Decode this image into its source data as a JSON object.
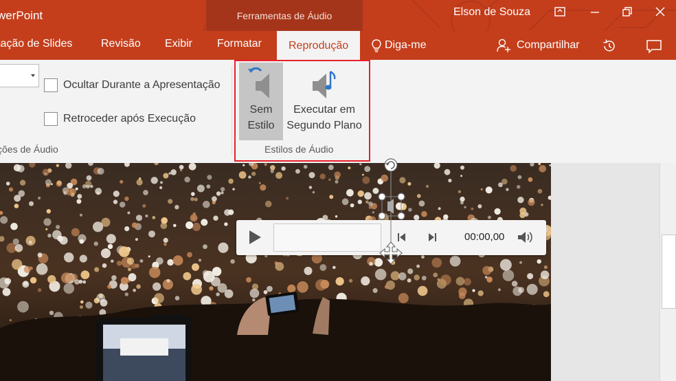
{
  "window": {
    "app_title": "werPoint",
    "tools_tab": "Ferramentas de Áudio",
    "user_name": "Elson de Souza",
    "controls": [
      "ribbon-display-icon",
      "minimize-icon",
      "restore-icon",
      "close-icon"
    ]
  },
  "tabs": [
    {
      "label": "tação de Slides",
      "active": false
    },
    {
      "label": "Revisão",
      "active": false
    },
    {
      "label": "Exibir",
      "active": false
    },
    {
      "label": "Formatar",
      "active": false
    },
    {
      "label": "Reprodução",
      "active": true
    }
  ],
  "tell_me": {
    "label": "Diga-me",
    "icon": "lightbulb-icon"
  },
  "share": {
    "label": "Compartilhar",
    "icon": "add-person-icon"
  },
  "toolbar_icons": [
    "history-icon",
    "comment-icon"
  ],
  "ribbon": {
    "audio_options": {
      "dropdown_value": "",
      "hide_during_show": {
        "label": "Ocultar Durante a Apresentação",
        "checked": false
      },
      "rewind_after_play": {
        "label": "Retroceder após Execução",
        "checked": false
      },
      "group_label": "ções de Áudio"
    },
    "audio_styles": {
      "no_style": {
        "line1": "Sem",
        "line2": "Estilo",
        "selected": true,
        "icon": "speaker-undo-icon"
      },
      "play_in_background": {
        "line1": "Executar em",
        "line2": "Segundo Plano",
        "selected": false,
        "icon": "speaker-music-icon"
      },
      "group_label": "Estilos de Áudio"
    }
  },
  "audio_player": {
    "time": "00:00,00",
    "progress": 0,
    "controls": [
      "play-icon",
      "skip-back-icon",
      "skip-forward-icon",
      "volume-icon"
    ]
  },
  "colors": {
    "accent": "#c43e1c",
    "accent_dark": "#a5351a",
    "ribbon_bg": "#f3f3f3",
    "highlight_box": "#e8202a"
  }
}
